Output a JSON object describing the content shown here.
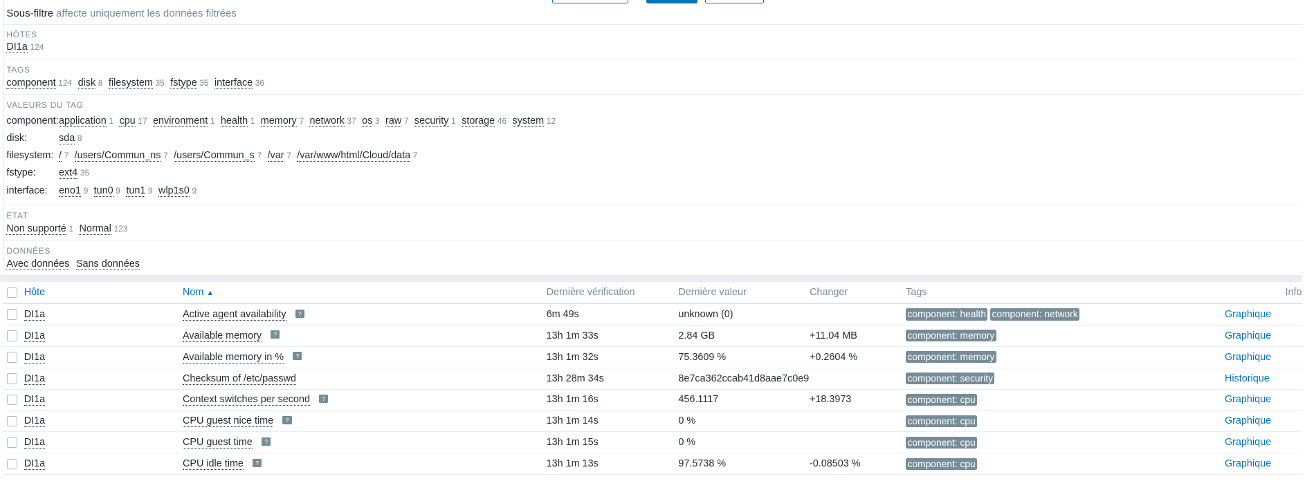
{
  "subfilter": {
    "title": "Sous-filtre",
    "subtitle": "affecte uniquement les données filtrées"
  },
  "hosts": {
    "label": "HÔTES",
    "items": [
      {
        "name": "DI1a",
        "count": "124"
      }
    ]
  },
  "tags": {
    "label": "TAGS",
    "items": [
      {
        "name": "component",
        "count": "124"
      },
      {
        "name": "disk",
        "count": "8"
      },
      {
        "name": "filesystem",
        "count": "35"
      },
      {
        "name": "fstype",
        "count": "35"
      },
      {
        "name": "interface",
        "count": "36"
      }
    ]
  },
  "tag_values": {
    "label": "VALEURS DU TAG",
    "rows": [
      {
        "key": "component:",
        "items": [
          {
            "name": "application",
            "count": "1"
          },
          {
            "name": "cpu",
            "count": "17"
          },
          {
            "name": "environment",
            "count": "1"
          },
          {
            "name": "health",
            "count": "1"
          },
          {
            "name": "memory",
            "count": "7"
          },
          {
            "name": "network",
            "count": "37"
          },
          {
            "name": "os",
            "count": "3"
          },
          {
            "name": "raw",
            "count": "7"
          },
          {
            "name": "security",
            "count": "1"
          },
          {
            "name": "storage",
            "count": "46"
          },
          {
            "name": "system",
            "count": "12"
          }
        ]
      },
      {
        "key": "disk:",
        "items": [
          {
            "name": "sda",
            "count": "8"
          }
        ]
      },
      {
        "key": "filesystem:",
        "items": [
          {
            "name": "/",
            "count": "7"
          },
          {
            "name": "/users/Commun_ns",
            "count": "7"
          },
          {
            "name": "/users/Commun_s",
            "count": "7"
          },
          {
            "name": "/var",
            "count": "7"
          },
          {
            "name": "/var/www/html/Cloud/data",
            "count": "7"
          }
        ]
      },
      {
        "key": "fstype:",
        "items": [
          {
            "name": "ext4",
            "count": "35"
          }
        ]
      },
      {
        "key": "interface:",
        "items": [
          {
            "name": "eno1",
            "count": "9"
          },
          {
            "name": "tun0",
            "count": "9"
          },
          {
            "name": "tun1",
            "count": "9"
          },
          {
            "name": "wlp1s0",
            "count": "9"
          }
        ]
      }
    ]
  },
  "state": {
    "label": "ÉTAT",
    "items": [
      {
        "name": "Non supporté",
        "count": "1"
      },
      {
        "name": "Normal",
        "count": "123"
      }
    ]
  },
  "data_sec": {
    "label": "DONNÉES",
    "items": [
      {
        "name": "Avec données",
        "count": ""
      },
      {
        "name": "Sans données",
        "count": ""
      }
    ]
  },
  "table": {
    "headers": {
      "host": "Hôte",
      "name": "Nom",
      "last_check": "Dernière vérification",
      "last_value": "Dernière valeur",
      "change": "Changer",
      "tags": "Tags",
      "info": "Info"
    },
    "sort_indicator": "▲",
    "rows": [
      {
        "host": "DI1a",
        "name": "Active agent availability",
        "help": true,
        "last_check": "6m 49s",
        "last_value": "unknown (0)",
        "change": "",
        "tags": [
          "component: health",
          "component: network"
        ],
        "link": "Graphique"
      },
      {
        "host": "DI1a",
        "name": "Available memory",
        "help": true,
        "last_check": "13h 1m 33s",
        "last_value": "2.84 GB",
        "change": "+11.04 MB",
        "tags": [
          "component: memory"
        ],
        "link": "Graphique"
      },
      {
        "host": "DI1a",
        "name": "Available memory in %",
        "help": true,
        "last_check": "13h 1m 32s",
        "last_value": "75.3609 %",
        "change": "+0.2604 %",
        "tags": [
          "component: memory"
        ],
        "link": "Graphique"
      },
      {
        "host": "DI1a",
        "name": "Checksum of /etc/passwd",
        "help": false,
        "last_check": "13h 28m 34s",
        "last_value": "8e7ca362ccab41d8aae7c0e98…",
        "change": "",
        "tags": [
          "component: security"
        ],
        "link": "Historique"
      },
      {
        "host": "DI1a",
        "name": "Context switches per second",
        "help": true,
        "last_check": "13h 1m 16s",
        "last_value": "456.1117",
        "change": "+18.3973",
        "tags": [
          "component: cpu"
        ],
        "link": "Graphique"
      },
      {
        "host": "DI1a",
        "name": "CPU guest nice time",
        "help": true,
        "last_check": "13h 1m 14s",
        "last_value": "0 %",
        "change": "",
        "tags": [
          "component: cpu"
        ],
        "link": "Graphique"
      },
      {
        "host": "DI1a",
        "name": "CPU guest time",
        "help": true,
        "last_check": "13h 1m 15s",
        "last_value": "0 %",
        "change": "",
        "tags": [
          "component: cpu"
        ],
        "link": "Graphique"
      },
      {
        "host": "DI1a",
        "name": "CPU idle time",
        "help": true,
        "last_check": "13h 1m 13s",
        "last_value": "97.5738 %",
        "change": "-0.08503 %",
        "tags": [
          "component: cpu"
        ],
        "link": "Graphique"
      }
    ]
  }
}
